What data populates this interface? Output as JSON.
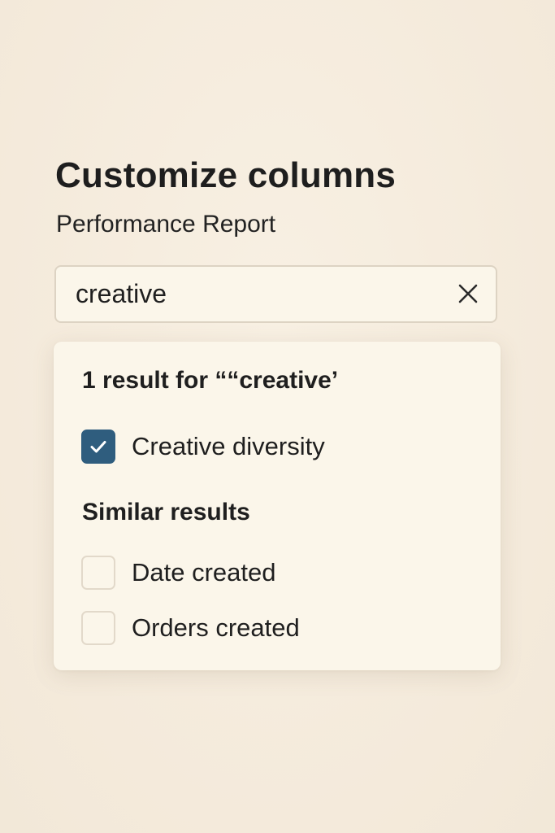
{
  "header": {
    "title": "Customize columns",
    "subtitle": "Performance Report"
  },
  "search": {
    "value": "creative",
    "clear_icon": "close-icon"
  },
  "results": {
    "heading": "1 result for ““creative’",
    "items": [
      {
        "label": "Creative diversity",
        "checked": true
      }
    ]
  },
  "similar": {
    "heading": "Similar results",
    "items": [
      {
        "label": "Date created",
        "checked": false
      },
      {
        "label": "Orders created",
        "checked": false
      }
    ]
  },
  "colors": {
    "background": "#f5ecdd",
    "panel": "#fbf6ea",
    "accent": "#2f5d7e",
    "border": "#ddd3c3"
  }
}
